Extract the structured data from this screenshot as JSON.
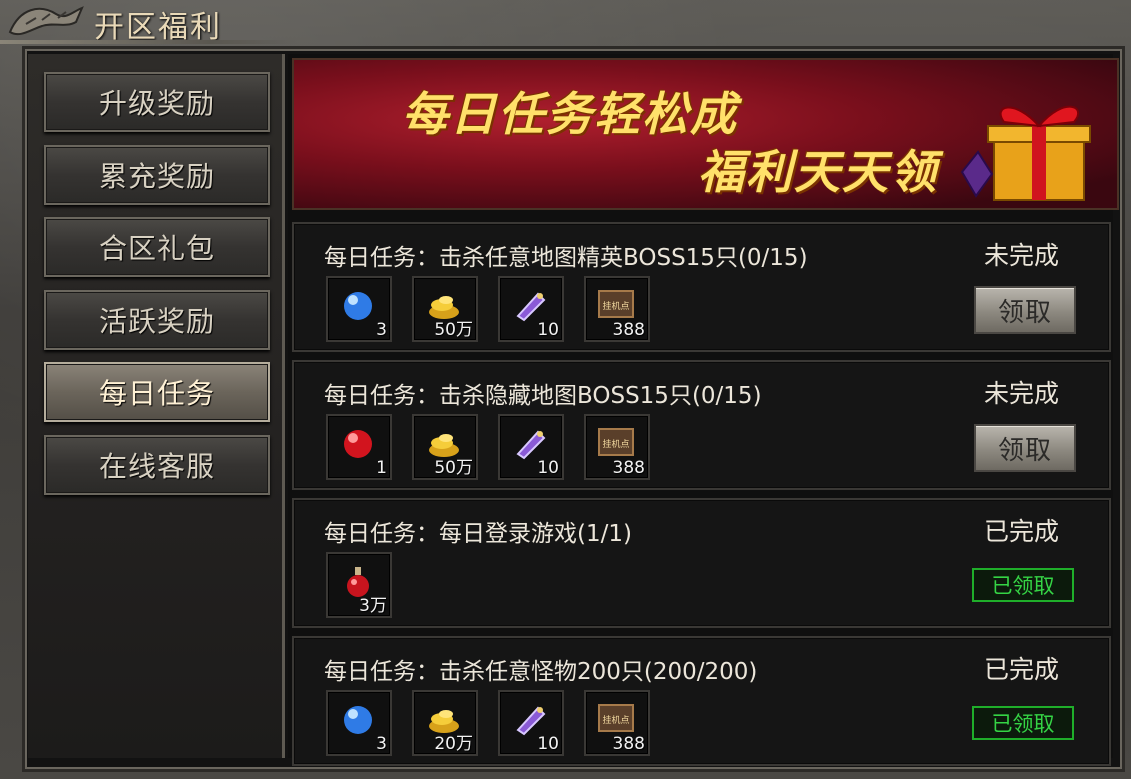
{
  "window": {
    "title": "开区福利"
  },
  "sidebar": {
    "items": [
      {
        "label": "升级奖励"
      },
      {
        "label": "累充奖励"
      },
      {
        "label": "合区礼包"
      },
      {
        "label": "活跃奖励"
      },
      {
        "label": "每日任务",
        "active": true
      },
      {
        "label": "在线客服"
      }
    ]
  },
  "banner": {
    "line1": "每日任务轻松成",
    "line2": "福利天天领"
  },
  "tasks": [
    {
      "title": "每日任务：击杀任意地图精英BOSS15只(0/15)",
      "status": "未完成",
      "action": "领取",
      "items": [
        {
          "icon": "blue-orb-icon",
          "count": "3"
        },
        {
          "icon": "gold-coins-icon",
          "count": "50万"
        },
        {
          "icon": "scroll-icon",
          "count": "10"
        },
        {
          "icon": "afk-points-icon",
          "count": "388"
        }
      ]
    },
    {
      "title": "每日任务：击杀隐藏地图BOSS15只(0/15)",
      "status": "未完成",
      "action": "领取",
      "items": [
        {
          "icon": "red-orb-icon",
          "count": "1"
        },
        {
          "icon": "gold-coins-icon",
          "count": "50万"
        },
        {
          "icon": "scroll-icon",
          "count": "10"
        },
        {
          "icon": "afk-points-icon",
          "count": "388"
        }
      ]
    },
    {
      "title": "每日任务：每日登录游戏(1/1)",
      "status": "已完成",
      "action": "已领取",
      "items": [
        {
          "icon": "red-potion-icon",
          "count": "3万"
        }
      ]
    },
    {
      "title": "每日任务：击杀任意怪物200只(200/200)",
      "status": "已完成",
      "action": "已领取",
      "items": [
        {
          "icon": "blue-orb-icon",
          "count": "3"
        },
        {
          "icon": "gold-coins-icon",
          "count": "20万"
        },
        {
          "icon": "scroll-icon",
          "count": "10"
        },
        {
          "icon": "afk-points-icon",
          "count": "388"
        }
      ]
    }
  ],
  "icon_labels": {
    "afk_points": "挂机点"
  },
  "colors": {
    "claimed_green": "#35d445",
    "banner_red": "#b01f2e",
    "banner_text": "#ffe16a"
  }
}
